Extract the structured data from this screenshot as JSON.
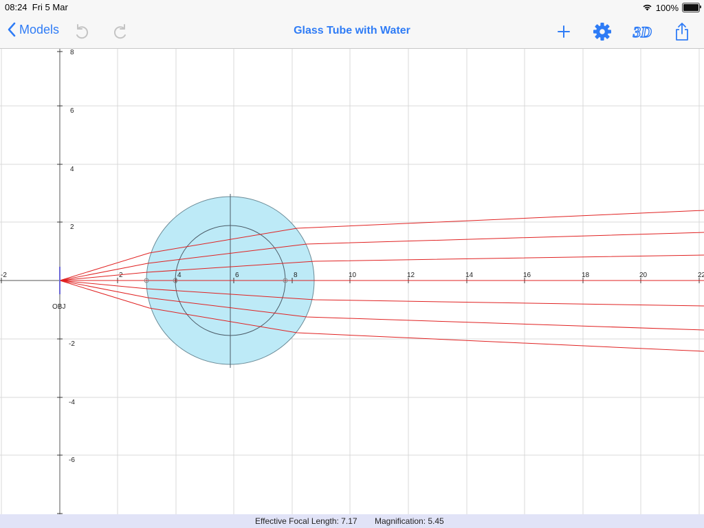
{
  "status": {
    "time": "08:24",
    "date": "Fri 5 Mar",
    "battery": "100%",
    "battery_level": 1.0
  },
  "nav": {
    "back_label": "Models",
    "title": "Glass Tube with Water"
  },
  "axes": {
    "x_ticks": [
      "-2",
      "2",
      "4",
      "6",
      "8",
      "10",
      "12",
      "14",
      "16",
      "18",
      "20",
      "22"
    ],
    "y_ticks": [
      "8",
      "6",
      "4",
      "2",
      "-2",
      "-4",
      "-6",
      "-8"
    ]
  },
  "object": {
    "label": "OBJ"
  },
  "info": {
    "focal_length": "Effective Focal Length: 7.17",
    "magnification": "Magnification: 5.45"
  },
  "colors": {
    "accent": "#2f7cf6",
    "ray": "#e02020",
    "glass": "#bdeaf7",
    "info_bg": "#e1e3f7"
  }
}
